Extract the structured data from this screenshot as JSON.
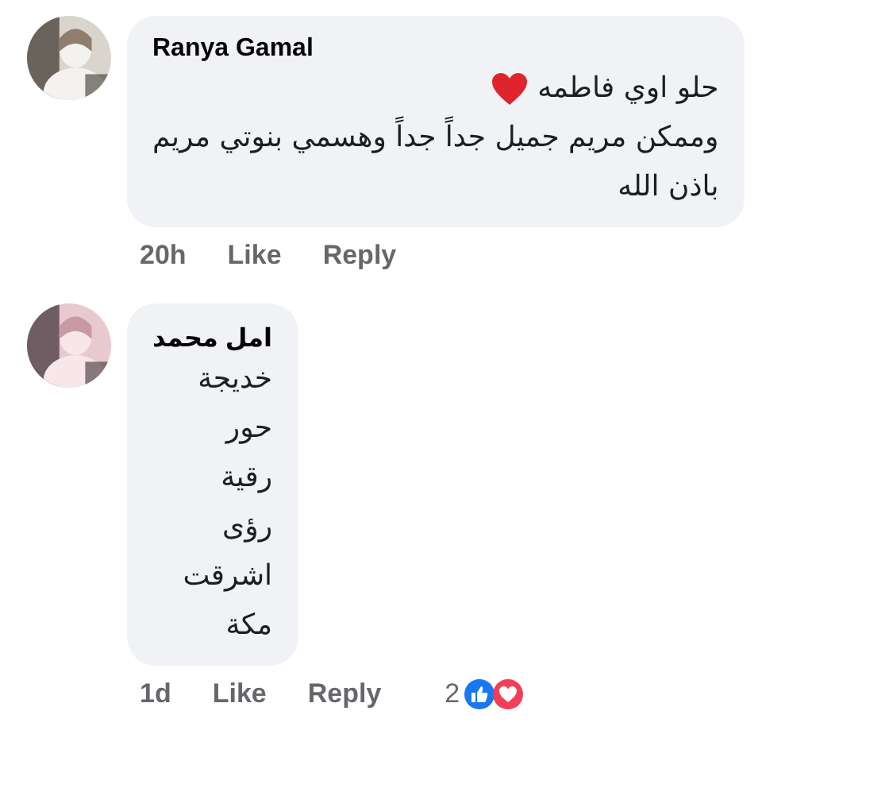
{
  "comments": [
    {
      "author": "Ranya Gamal",
      "lines": [
        {
          "text": "حلو اوي فاطمه",
          "heart": true
        },
        {
          "text": "وممكن مريم جميل جداً جداً وهسمي بنوتي مريم"
        },
        {
          "text": "باذن الله"
        }
      ],
      "time": "20h",
      "like": "Like",
      "reply": "Reply"
    },
    {
      "author": "امل محمد",
      "lines": [
        {
          "text": "خديجة"
        },
        {
          "text": "حور"
        },
        {
          "text": "رقية"
        },
        {
          "text": "رؤى"
        },
        {
          "text": "اشرقت"
        },
        {
          "text": "مكة"
        }
      ],
      "time": "1d",
      "like": "Like",
      "reply": "Reply",
      "reactions": {
        "count": "2",
        "like": true,
        "love": true
      }
    }
  ]
}
